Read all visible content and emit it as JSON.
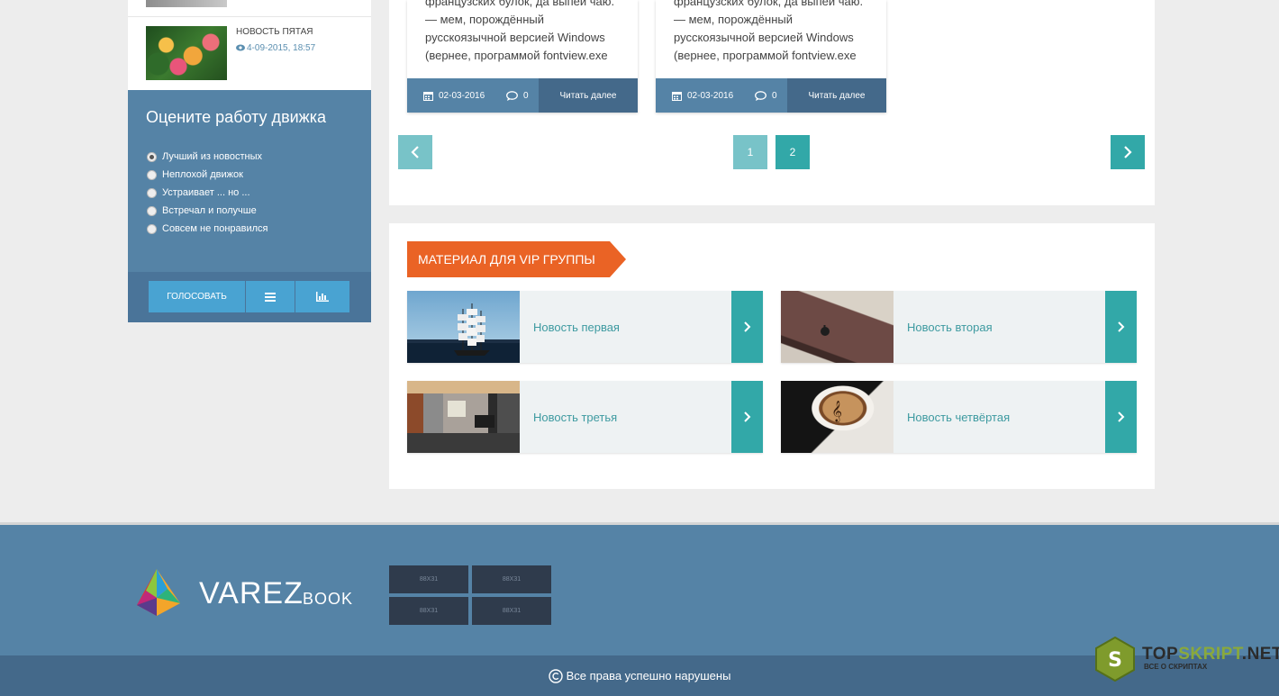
{
  "sidebar": {
    "news": {
      "title": "Новость пятая",
      "date": "4-09-2015, 18:57"
    },
    "poll": {
      "title": "Оцените работу движка",
      "options": [
        "Лучший из новостных",
        "Неплохой движок",
        "Устраивает ... но ...",
        "Встречал и получше",
        "Совсем не понравился"
      ],
      "vote_label": "Голосовать",
      "list_icon": "list-icon",
      "results_icon": "bar-chart-icon"
    }
  },
  "main": {
    "cards": [
      {
        "text": "французских булок, да выпей чаю. — мем, порождённый русскоязычной версией Windows (вернее, программой fontview.exe",
        "date": "02-03-2016",
        "comments": "0",
        "more_label": "Читать далее"
      },
      {
        "text": "французских булок, да выпей чаю. — мем, порождённый русскоязычной версией Windows (вернее, программой fontview.exe",
        "date": "02-03-2016",
        "comments": "0",
        "more_label": "Читать далее"
      }
    ],
    "pagination": {
      "pages": [
        "1",
        "2"
      ]
    },
    "vip": {
      "heading": "Материал для VIP группы",
      "items": [
        {
          "title": "Новость первая"
        },
        {
          "title": "Новость вторая"
        },
        {
          "title": "Новость третья"
        },
        {
          "title": "Новость четвёртая"
        }
      ]
    }
  },
  "footer": {
    "logo_main": "VAREZ",
    "logo_sub": "BOOK",
    "banners": [
      "88X31",
      "88X31",
      "88X31",
      "88X31"
    ],
    "copyright": "Все права успешно нарушены"
  },
  "watermark": {
    "name_a": "TOP",
    "name_b": "SKRIPT",
    "name_c": ".NET",
    "tagline": "ВСЕ О СКРИПТАХ"
  },
  "colors": {
    "primary_blue": "#5583a6",
    "dark_blue": "#44698a",
    "teal": "#32a8a8",
    "orange": "#ea6325"
  }
}
